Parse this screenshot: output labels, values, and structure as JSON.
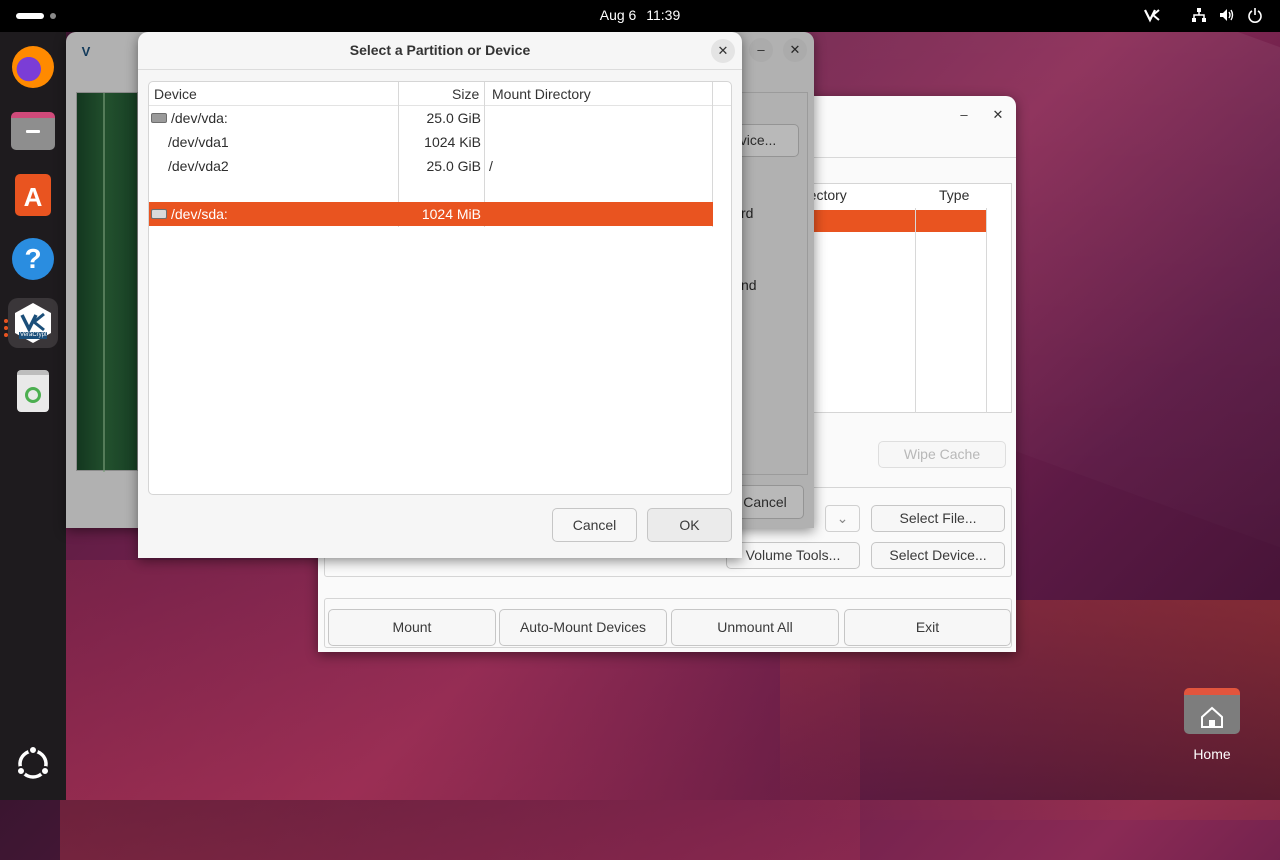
{
  "topbar": {
    "date": "Aug 6",
    "time": "11:39"
  },
  "dock": {
    "items": [
      "firefox-icon",
      "files-icon",
      "app-center-icon",
      "help-icon",
      "veracrypt-icon",
      "trash-icon"
    ],
    "veracrypt_label": "VeraCrypt",
    "ubuntu_icon": "ubuntu-logo-icon"
  },
  "dialog": {
    "title": "Select a Partition or Device",
    "columns": [
      "Device",
      "Size",
      "Mount Directory"
    ],
    "rows": [
      {
        "device": "/dev/vda:",
        "size": "25.0 GiB",
        "mount": ""
      },
      {
        "device": "/dev/vda1",
        "size": "1024 KiB",
        "mount": ""
      },
      {
        "device": "/dev/vda2",
        "size": "25.0 GiB",
        "mount": "/"
      },
      {
        "device": "/dev/sda:",
        "size": "1024 MiB",
        "mount": ""
      }
    ],
    "cancel_label": "Cancel",
    "ok_label": "OK"
  },
  "volume_window": {
    "peek_device_button": "vice...",
    "peek_text_1": "rd",
    "peek_text_2": "nd",
    "cancel_label": "Cancel"
  },
  "main_window": {
    "columns": [
      "rectory",
      "Type"
    ],
    "wipe_cache_label": "Wipe Cache",
    "select_file_label": "Select File...",
    "volume_tools_label": "Volume Tools...",
    "select_device_label": "Select Device...",
    "mount_label": "Mount",
    "auto_mount_label": "Auto-Mount Devices",
    "unmount_all_label": "Unmount All",
    "exit_label": "Exit"
  },
  "desktop": {
    "home_label": "Home"
  },
  "colors": {
    "accent": "#e95420",
    "topbar": "#000000",
    "dock": "#1e1b1e"
  }
}
